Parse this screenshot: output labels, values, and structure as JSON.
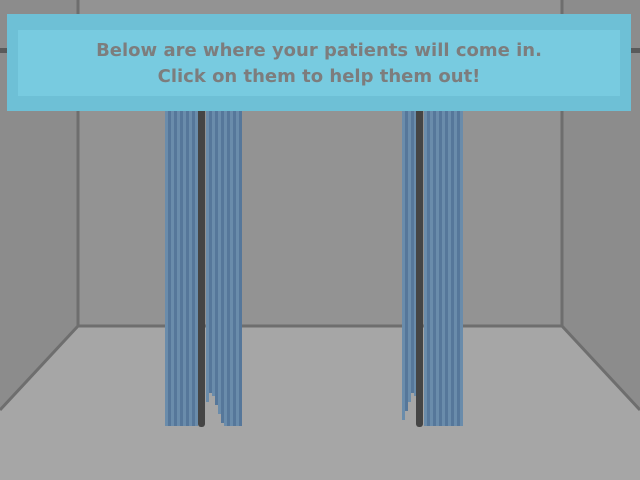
{
  "tutorial": {
    "line1": "Below are where your patients will come in.",
    "line2": "Click on them to help them out!"
  },
  "colors": {
    "wall": "#8a8a8a",
    "back_wall": "#939393",
    "floor": "#a5a5a5",
    "curtain": "#6a8cab",
    "curtain_dark": "#56779a",
    "pole": "#454545",
    "banner": "#78cbe0"
  },
  "patient_slots": [
    {
      "name": "curtain-left"
    },
    {
      "name": "curtain-right"
    }
  ]
}
